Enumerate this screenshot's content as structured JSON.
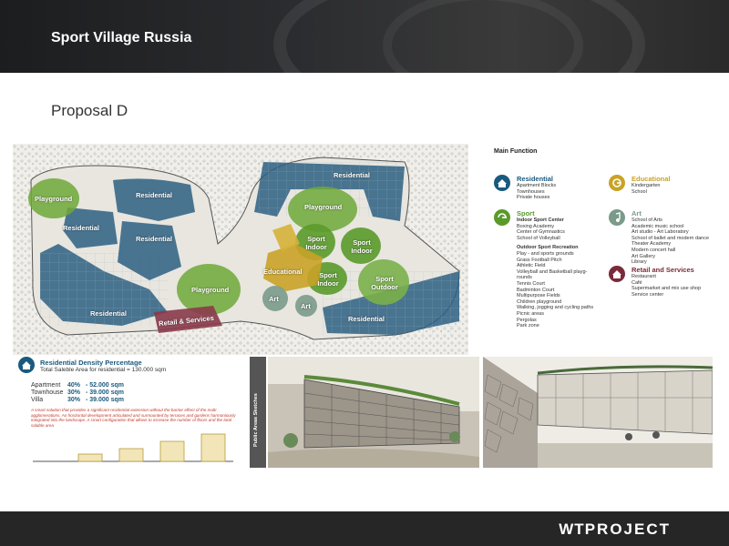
{
  "header": {
    "title": "Sport Village Russia"
  },
  "page": {
    "subtitle": "Proposal D"
  },
  "map": {
    "labels": {
      "playground_left": "Playground",
      "residential_tl": "Residential",
      "residential_left": "Residential",
      "residential_mid": "Residential",
      "residential_bottom_left": "Residential",
      "residential_top_right": "Residential",
      "playground_top_right": "Playground",
      "playground_mid": "Playground",
      "sport_indoor_1": "Sport Indoor",
      "sport_indoor_2": "Sport Indoor",
      "sport_indoor_3": "Sport Indoor",
      "sport_outdoor": "Sport Outdoor",
      "educational": "Educational",
      "art_1": "Art",
      "art_2": "Art",
      "retail": "Retail & Services",
      "residential_bottom_right": "Residential"
    }
  },
  "legend": {
    "title": "Main Function",
    "residential": {
      "title": "Residential",
      "items": [
        "Apartment Blocks",
        "Townhouses",
        "Private houses"
      ],
      "color": "#1a5a7e"
    },
    "educational": {
      "title": "Educational",
      "items": [
        "Kindergarten",
        "School"
      ],
      "color": "#c9a227"
    },
    "sport": {
      "title": "Sport",
      "items": [
        "Indoor Sport Center",
        "Boxing Academy",
        "Center of Gymnastics",
        "School of Volleyball",
        "",
        "Outdoor Sport Recreation",
        "Play - and sports grounds",
        "Grass Football Pitch",
        "Athletic Field",
        "Volleyball and Basketball playg-",
        "rounds",
        "Tennis Court",
        "Badminton Court",
        "Multipurpose Fields",
        "Children playground",
        "Walking, jogging and cycling paths",
        "Picnic areas",
        "Pergolas",
        "Park zone"
      ],
      "color": "#5a9a2a"
    },
    "art": {
      "title": "Art",
      "items": [
        "School of Arts",
        "Academic music school",
        "Art studio - Art Laboratory",
        "School of ballet and modern dance",
        "Theater Academy",
        "Modern concert hall",
        "Art Gallery",
        "Library"
      ],
      "color": "#7a9a8a"
    },
    "retail": {
      "title": "Retail and Services",
      "items": [
        "Restaurant",
        "Café",
        "Supermarket and mix use shop",
        "Service center"
      ],
      "color": "#7a2a3a"
    }
  },
  "density": {
    "title": "Residential Density Percentage",
    "subtitle": "Total Saleble Area for residential  =  130.000 sqm",
    "rows": [
      {
        "name": "Apartment",
        "pct": "40%",
        "val": "-  52.000 sqm"
      },
      {
        "name": "Townhouse",
        "pct": "30%",
        "val": "-  39.000 sqm"
      },
      {
        "name": "Villa",
        "pct": "30%",
        "val": "-  39.000 sqm"
      }
    ],
    "note": "A smart solution that provides a significant residential extension without the barrier effect of the multi agglomerations. An horizontal development articulated and surmounted by terraces and gardens harmoniously integrated into the landscape. A smart configuration that allows to increase the number of floors and the total salable area"
  },
  "sketches": {
    "label": "Public Areas Sketches"
  },
  "footer": {
    "logo_wt": "WT",
    "logo_rest": "PROJECT"
  }
}
